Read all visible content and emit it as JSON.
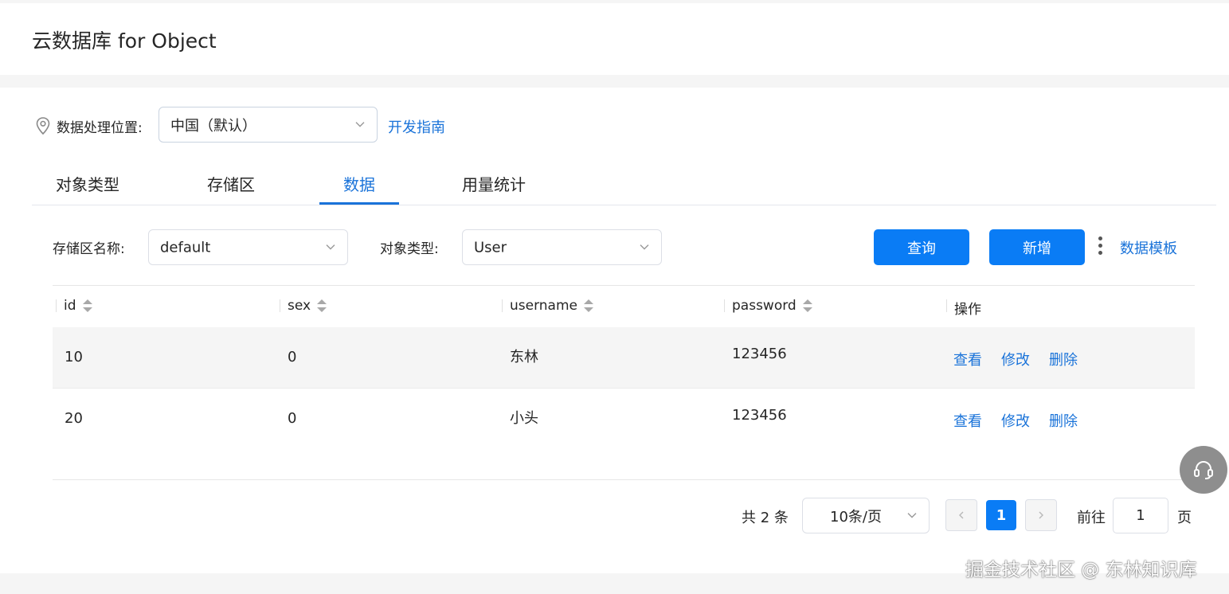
{
  "header": {
    "title": "云数据库 for Object"
  },
  "location": {
    "label": "数据处理位置:",
    "selected": "中国（默认）",
    "guide_link": "开发指南"
  },
  "tabs": [
    {
      "label": "对象类型"
    },
    {
      "label": "存储区"
    },
    {
      "label": "数据",
      "active": true
    },
    {
      "label": "用量统计"
    }
  ],
  "filters": {
    "storage_label": "存储区名称:",
    "storage_value": "default",
    "type_label": "对象类型:",
    "type_value": "User",
    "query_button": "查询",
    "add_button": "新增",
    "template_link": "数据模板"
  },
  "table": {
    "columns": [
      "id",
      "sex",
      "username",
      "password",
      "操作"
    ],
    "rows": [
      {
        "id": "10",
        "sex": "0",
        "username": "东林",
        "password": "123456"
      },
      {
        "id": "20",
        "sex": "0",
        "username": "小头",
        "password": "123456"
      }
    ],
    "actions": [
      "查看",
      "修改",
      "删除"
    ]
  },
  "pagination": {
    "total": "共 2 条",
    "page_size": "10条/页",
    "current_page": "1",
    "goto_prefix": "前往",
    "goto_value": "1",
    "goto_suffix": "页"
  },
  "watermark": "掘金技术社区 @ 东林知识库",
  "colors": {
    "accent": "#0a7cf5",
    "link": "#1a73d9"
  }
}
